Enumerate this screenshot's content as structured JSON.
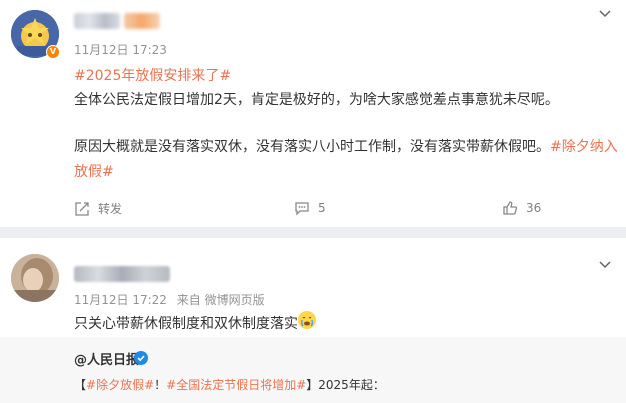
{
  "post": {
    "time": "11月12日 17:23",
    "hashtag_title": "#2025年放假安排来了#",
    "line1": "全体公民法定假日增加2天，肯定是极好的，为啥大家感觉差点事意犹未尽呢。",
    "line2_prefix": "原因大概就是没有落实双休，没有落实八小时工作制，没有落实带薪休假吧。",
    "line2_tag_a": "#除夕纳入",
    "line3_tag_b": "放假#",
    "actions": {
      "repost_label": "转发",
      "comment_count": "5",
      "like_count": "36"
    },
    "icons": [
      "chevron-down-icon",
      "repost-icon",
      "comment-icon",
      "like-icon",
      "verified-badge-icon"
    ]
  },
  "second_post": {
    "time": "11月12日 17:22",
    "source": "来自 微博网页版",
    "content": "只关心带薪休假制度和双休制度落实",
    "quote": {
      "author": "@人民日报",
      "bracket_open": "【",
      "tag1": "#除夕放假#",
      "excl": "！",
      "tag2": "#全国法定节假日将增加#",
      "tail": "】2025年起："
    }
  },
  "colors": {
    "accent": "#eb7350",
    "brand_orange": "#ff8200",
    "verified_blue": "#1c8ae6",
    "meta_gray": "#939393"
  }
}
